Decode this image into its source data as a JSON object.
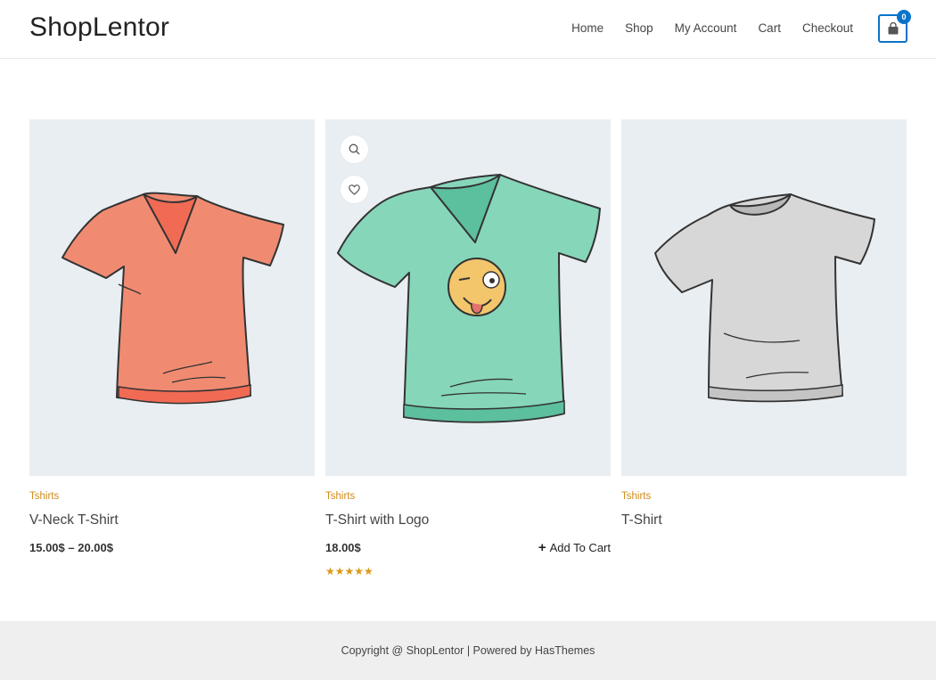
{
  "header": {
    "logo": "ShopLentor",
    "nav": [
      "Home",
      "Shop",
      "My Account",
      "Cart",
      "Checkout"
    ],
    "cart_count": "0"
  },
  "products": [
    {
      "category": "Tshirts",
      "title": "V-Neck T-Shirt",
      "price": "15.00$ – 20.00$",
      "color": "#f0846c"
    },
    {
      "category": "Tshirts",
      "title": "T-Shirt with Logo",
      "price": "18.00$",
      "add_to_cart": "Add To Cart",
      "rating_stars": "★★★★★",
      "rating": 5,
      "color": "#7fd1b5"
    },
    {
      "category": "Tshirts",
      "title": "T-Shirt",
      "price": "",
      "color": "#d6d6d6"
    }
  ],
  "footer": {
    "text": "Copyright @ ShopLentor | Powered by HasThemes"
  },
  "colors": {
    "accent": "#0a74c9",
    "category": "#d08c1a",
    "stars": "#d99a17",
    "thumb_bg": "#e9eef2",
    "footer_bg": "#efefef"
  }
}
